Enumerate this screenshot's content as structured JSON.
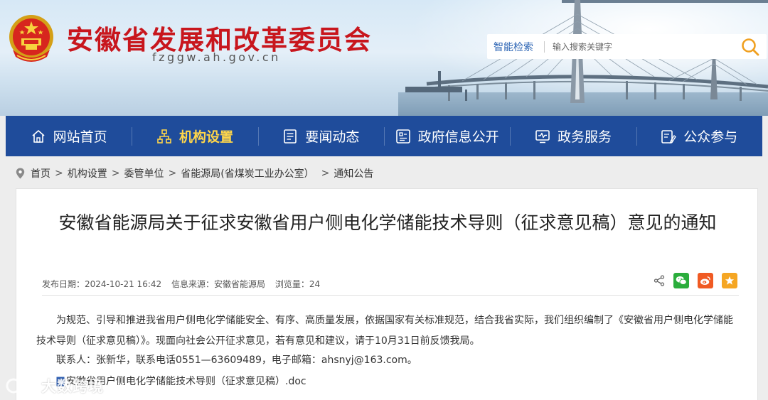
{
  "header": {
    "site_title": "安徽省发展和改革委员会",
    "site_domain": "fzggw.ah.gov.cn",
    "search": {
      "type_label": "智能检索",
      "placeholder": "输入搜索关键字"
    }
  },
  "nav": {
    "items": [
      {
        "label": "网站首页",
        "icon": "home-icon"
      },
      {
        "label": "机构设置",
        "icon": "org-chart-icon",
        "active": true
      },
      {
        "label": "要闻动态",
        "icon": "news-icon"
      },
      {
        "label": "政府信息公开",
        "icon": "info-disclosure-icon"
      },
      {
        "label": "政务服务",
        "icon": "service-monitor-icon"
      },
      {
        "label": "公众参与",
        "icon": "participation-icon"
      }
    ]
  },
  "breadcrumb": {
    "items": [
      "首页",
      "机构设置",
      "委管单位",
      "省能源局(省煤炭工业办公室）",
      "通知公告"
    ],
    "separator": ">"
  },
  "article": {
    "title": "安徽省能源局关于征求安徽省用户侧电化学储能技术导则（征求意见稿）意见的通知",
    "meta": {
      "date": "发布日期：2024-10-21 16:42",
      "source": "信息来源：安徽省能源局",
      "views": "浏览量：24"
    },
    "share_icons": [
      "share-icon",
      "wechat-icon",
      "weibo-icon",
      "favorite-icon"
    ],
    "body": "为规范、引导和推进我省用户侧电化学储能安全、有序、高质量发展，依据国家有关标准规范，结合我省实际，我们组织编制了《安徽省用户侧电化学储能技术导则（征求意见稿）》。现面向社会公开征求意见，若有意见和建议，请于10月31日前反馈我局。",
    "contact": "联系人：张新华，联系电话0551—63609489，电子邮箱：ahsnyj@163.com。",
    "attachment": "安徽省用户侧电化学储能技术导则（征求意见稿）.doc"
  },
  "watermark": {
    "text": "大数跨境"
  },
  "colors": {
    "brand_red": "#c8161d",
    "nav_blue": "#1f4c9b",
    "nav_active": "#ffd64a",
    "link_blue": "#2a63b3",
    "search_orange": "#f0a020"
  }
}
